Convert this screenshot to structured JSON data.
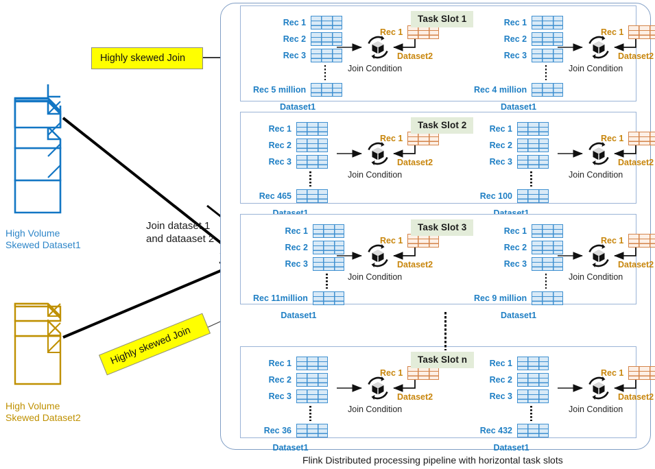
{
  "figure": {
    "footer_caption": "Flink Distributed processing pipeline with horizontal task slots",
    "center_note_line1": "Join dataset 1",
    "center_note_line2": "and dataaset 2"
  },
  "colors": {
    "dataset1_blue": "#1f7fc4",
    "dataset2_gold": "#c8860d",
    "callout_yellow": "#ffff00",
    "slot_badge_green": "#e3ecd9",
    "container_border": "#7f9dc4"
  },
  "sources": [
    {
      "id": "source-dataset1",
      "caption_line1": "High Volume",
      "caption_line2": "Skewed Dataset1",
      "color": "#1f7fc4"
    },
    {
      "id": "source-dataset2",
      "caption_line1": "High Volume",
      "caption_line2": "Skewed Dataset2",
      "color": "#bf9000"
    }
  ],
  "callouts": [
    {
      "id": "callout-top",
      "label": "Highly skewed Join"
    },
    {
      "id": "callout-bottom",
      "label": "Highly skewed Join"
    }
  ],
  "slots": [
    {
      "badge": "Task Slot 1",
      "left": {
        "records": [
          "Rec 1",
          "Rec 2",
          "Rec 3"
        ],
        "last_record": "Rec 5 million",
        "dataset_label": "Dataset1",
        "join_label": "Join Condition",
        "right_record": "Rec 1",
        "right_dataset_label": "Dataset2"
      },
      "right": {
        "records": [
          "Rec 1",
          "Rec 2",
          "Rec 3"
        ],
        "last_record": "Rec 4 million",
        "dataset_label": "Dataset1",
        "join_label": "Join Condition",
        "right_record": "Rec 1",
        "right_dataset_label": "Dataset2"
      }
    },
    {
      "badge": "Task Slot 2",
      "left": {
        "records": [
          "Rec 1",
          "Rec 2",
          "Rec 3"
        ],
        "last_record": "Rec 465",
        "dataset_label": "Dataset1",
        "join_label": "Join Condition",
        "right_record": "Rec 1",
        "right_dataset_label": "Dataset2"
      },
      "right": {
        "records": [
          "Rec 1",
          "Rec 2",
          "Rec 3"
        ],
        "last_record": "Rec 100",
        "dataset_label": "Dataset1",
        "join_label": "Join Condition",
        "right_record": "Rec 1",
        "right_dataset_label": "Dataset2"
      }
    },
    {
      "badge": "Task Slot 3",
      "left": {
        "records": [
          "Rec 1",
          "Rec 2",
          "Rec 3"
        ],
        "last_record": "Rec 11million",
        "dataset_label": "Dataset1",
        "join_label": "Join Condition",
        "right_record": "Rec 1",
        "right_dataset_label": "Dataset2"
      },
      "right": {
        "records": [
          "Rec 1",
          "Rec 2",
          "Rec 3"
        ],
        "last_record": "Rec 9 million",
        "dataset_label": "Dataset1",
        "join_label": "Join Condition",
        "right_record": "Rec 1",
        "right_dataset_label": "Dataset2"
      }
    },
    {
      "badge": "Task Slot n",
      "left": {
        "records": [
          "Rec 1",
          "Rec 2",
          "Rec 3"
        ],
        "last_record": "Rec 36",
        "dataset_label": "Dataset1",
        "join_label": "Join Condition",
        "right_record": "Rec 1",
        "right_dataset_label": "Dataset2"
      },
      "right": {
        "records": [
          "Rec 1",
          "Rec 2",
          "Rec 3"
        ],
        "last_record": "Rec 432",
        "dataset_label": "Dataset1",
        "join_label": "Join Condition",
        "right_record": "Rec 1",
        "right_dataset_label": "Dataset2"
      }
    }
  ]
}
